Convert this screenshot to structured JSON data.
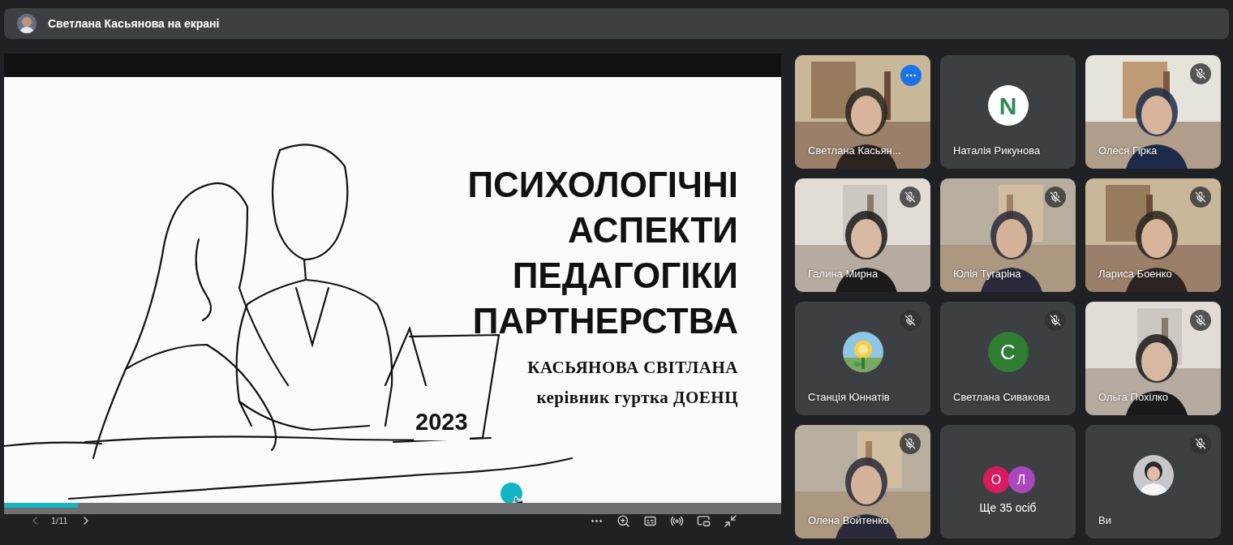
{
  "top_bar": {
    "title": "Светлана Касьянова на екрані"
  },
  "presentation": {
    "slide": {
      "title_lines": [
        "ПСИХОЛОГІЧНІ",
        "АСПЕКТИ",
        "ПЕДАГОГІКИ",
        "ПАРТНЕРСТВА"
      ],
      "author": "КАСЬЯНОВА СВІТЛАНА",
      "role": "керівник гуртка ДОЕНЦ",
      "year": "2023"
    },
    "progress": {
      "level": 0.095
    },
    "page_counter": "1/11"
  },
  "tiles": [
    {
      "name": "Светлана Касьян...",
      "kind": "video",
      "muted": false,
      "active": true
    },
    {
      "name": "Наталія Рикунова",
      "kind": "logo",
      "muted": false,
      "active": false,
      "avatar_text": "N"
    },
    {
      "name": "Олеся Гірка",
      "kind": "video",
      "muted": true,
      "active": false
    },
    {
      "name": "Галина Мирна",
      "kind": "video",
      "muted": true,
      "active": false
    },
    {
      "name": "Юлія Тугаріна",
      "kind": "video",
      "muted": true,
      "active": false
    },
    {
      "name": "Лариса Боенко",
      "kind": "video",
      "muted": true,
      "active": false
    },
    {
      "name": "Станція Юннатів",
      "kind": "picture_avatar",
      "muted": true,
      "active": false
    },
    {
      "name": "Светлана Сивакова",
      "kind": "letter",
      "muted": true,
      "active": false,
      "avatar_text": "C",
      "color": "#2e7d32"
    },
    {
      "name": "Ольга Похілко",
      "kind": "video",
      "muted": true,
      "active": false
    },
    {
      "name": "Олена Войтенко",
      "kind": "video",
      "muted": true,
      "active": false
    },
    {
      "name": "Ще 35 осіб",
      "kind": "others",
      "muted": false,
      "active": false,
      "avatars": [
        {
          "text": "О",
          "color": "#d81b60"
        },
        {
          "text": "Л",
          "color": "#ab47bc"
        }
      ]
    },
    {
      "name": "Ви",
      "kind": "photo_avatar",
      "muted": true,
      "active": false
    }
  ]
}
